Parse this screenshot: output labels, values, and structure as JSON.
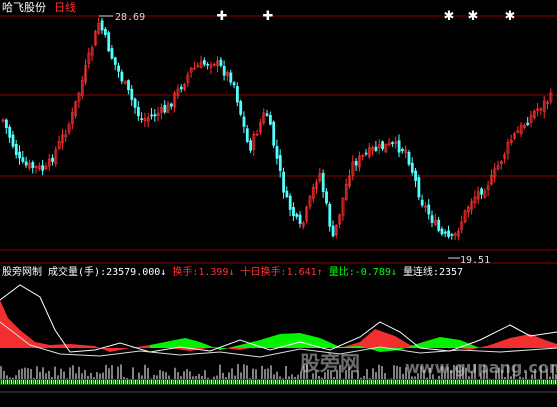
{
  "header": {
    "stock_name": "哈飞股份",
    "period": "日线",
    "high_price": "28.69",
    "low_price": "19.51"
  },
  "indicator": {
    "source": "股旁网制",
    "volume_label": "成交量(手):",
    "volume_value": "23579.000↓",
    "turnover_label": "换手:",
    "turnover_value": "1.399↓",
    "turnover10_label": "十日换手:",
    "turnover10_value": "1.641↑",
    "ratio_label": "量比:",
    "ratio_value": "-0.789↓",
    "streak_label": "量连线:",
    "streak_value": "2357"
  },
  "watermark": {
    "cn": "股旁网",
    "en": "www.gupang.com"
  },
  "colors": {
    "up": "#ff3030",
    "down": "#54ffff",
    "grid": "#8b0000",
    "label_red": "#ff3333",
    "label_green": "#00ff00",
    "label_white": "#ffffff"
  },
  "markers": [
    "star-icon",
    "star-icon",
    "star-icon",
    "star-icon",
    "star-icon"
  ]
}
